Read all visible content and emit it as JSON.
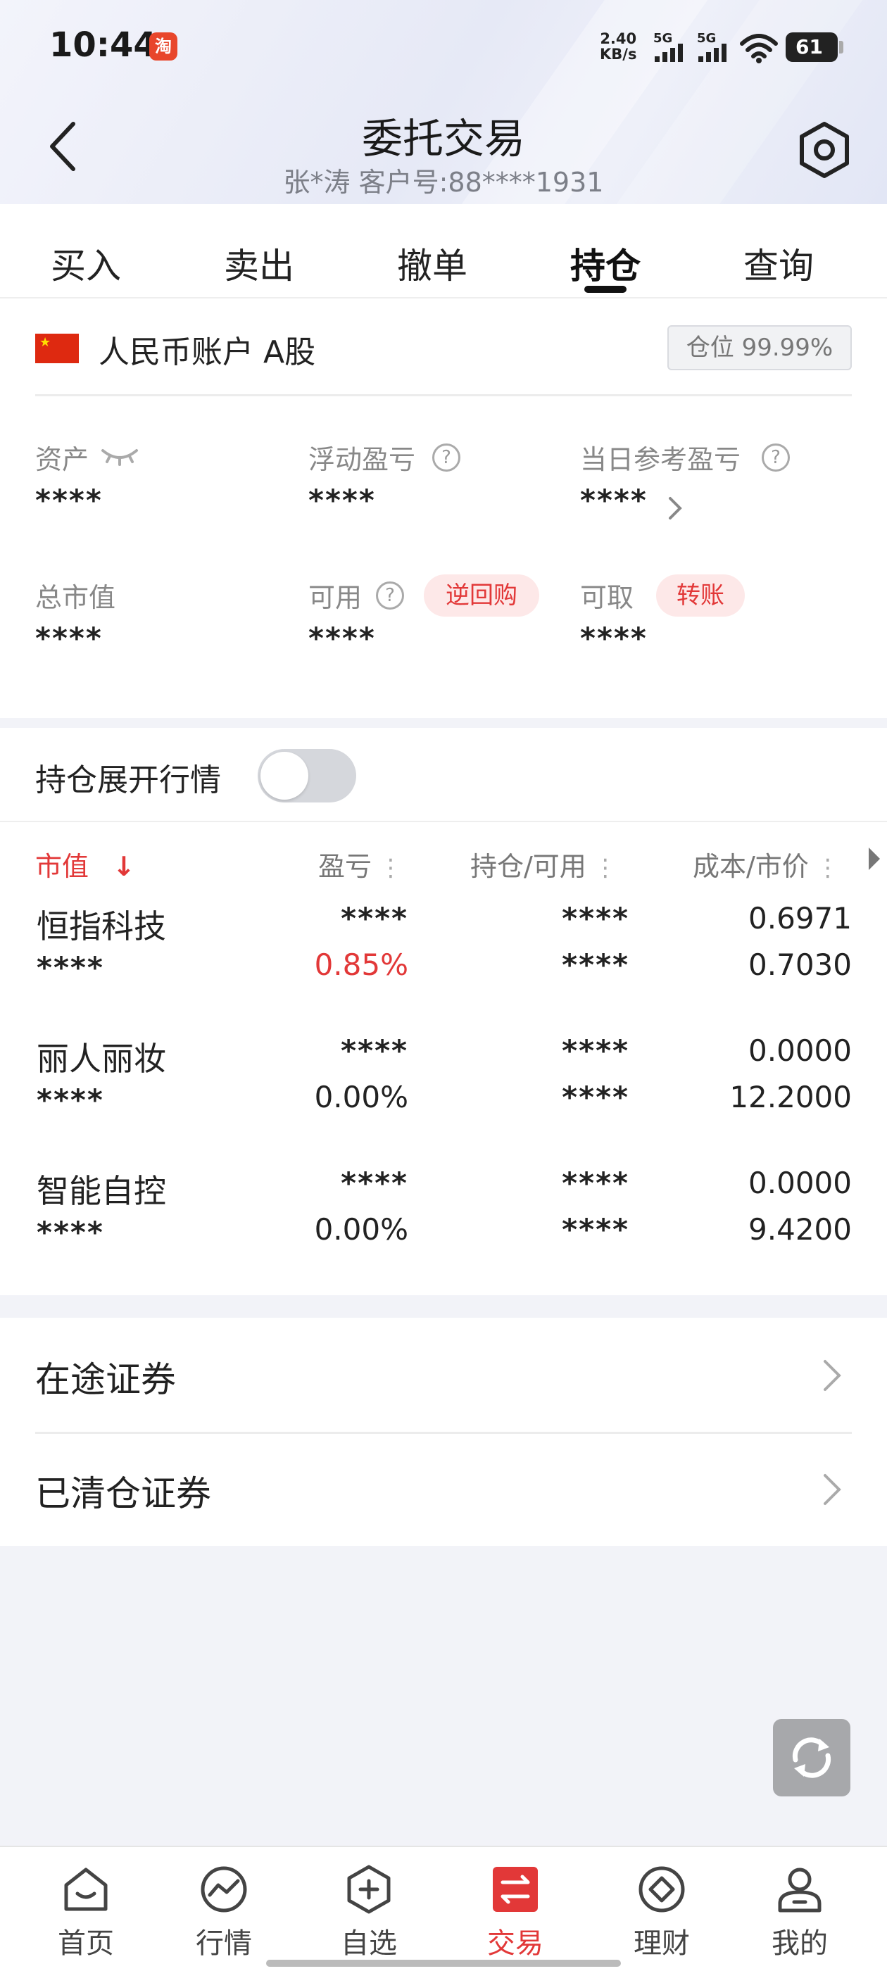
{
  "status_bar": {
    "time": "10:44",
    "app_badge": "淘",
    "net_speed_value": "2.40",
    "net_speed_unit": "KB/s",
    "signal1_label": "5G",
    "signal2_label": "5G",
    "battery": "61"
  },
  "header": {
    "title": "委托交易",
    "subtitle": "张*涛 客户号:88****1931"
  },
  "tabs": [
    {
      "label": "买入"
    },
    {
      "label": "卖出"
    },
    {
      "label": "撤单"
    },
    {
      "label": "持仓",
      "active": true
    },
    {
      "label": "查询"
    }
  ],
  "account": {
    "name": "人民币账户 A股",
    "position_ratio": "仓位 99.99%",
    "stats": {
      "assets": {
        "label": "资产",
        "value": "****"
      },
      "floating_pnl": {
        "label": "浮动盈亏",
        "value": "****"
      },
      "daily_pnl": {
        "label": "当日参考盈亏",
        "value": "****"
      },
      "market_value": {
        "label": "总市值",
        "value": "****"
      },
      "available": {
        "label": "可用",
        "value": "****",
        "action": "逆回购"
      },
      "withdrawable": {
        "label": "可取",
        "value": "****",
        "action": "转账"
      }
    }
  },
  "toggle": {
    "label": "持仓展开行情",
    "on": false
  },
  "table": {
    "headers": {
      "market_value": "市值",
      "sort_arrow": "↓",
      "pnl": "盈亏",
      "holding": "持仓/可用",
      "cost": "成本/市价",
      "menu_dots": "⋮"
    },
    "rows": [
      {
        "name": "恒指科技",
        "value": "****",
        "pnl": "****",
        "pnl_pct": "0.85%",
        "holding": "****",
        "available": "****",
        "cost": "0.6971",
        "price": "0.7030",
        "positive": true
      },
      {
        "name": "丽人丽妆",
        "value": "****",
        "pnl": "****",
        "pnl_pct": "0.00%",
        "holding": "****",
        "available": "****",
        "cost": "0.0000",
        "price": "12.2000",
        "positive": false
      },
      {
        "name": "智能自控",
        "value": "****",
        "pnl": "****",
        "pnl_pct": "0.00%",
        "holding": "****",
        "available": "****",
        "cost": "0.0000",
        "price": "9.4200",
        "positive": false
      }
    ]
  },
  "links": [
    {
      "label": "在途证券"
    },
    {
      "label": "已清仓证券"
    }
  ],
  "bottom_nav": [
    {
      "label": "首页",
      "icon": "home-icon"
    },
    {
      "label": "行情",
      "icon": "market-icon"
    },
    {
      "label": "自选",
      "icon": "watchlist-icon"
    },
    {
      "label": "交易",
      "icon": "trade-icon",
      "active": true
    },
    {
      "label": "理财",
      "icon": "wealth-icon"
    },
    {
      "label": "我的",
      "icon": "profile-icon"
    }
  ],
  "colors": {
    "accent_red": "#e23838",
    "pill_bg": "#fde8e8",
    "page_bg": "#f2f3f8"
  }
}
